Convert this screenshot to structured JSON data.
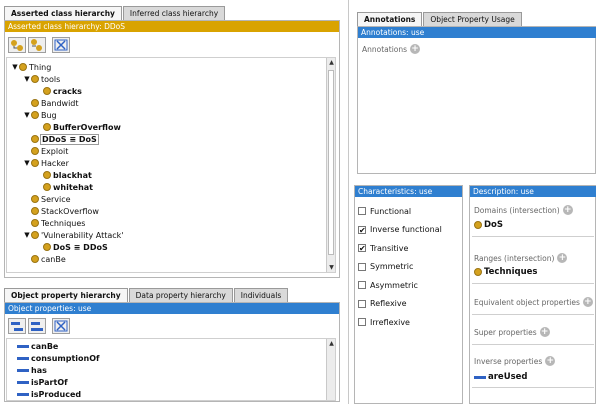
{
  "left_tabs": [
    "Asserted class hierarchy",
    "Inferred class hierarchy"
  ],
  "class_header": "Asserted class hierarchy: DDoS",
  "class_tree": [
    {
      "label": "Thing",
      "expanded": true,
      "bold": false
    },
    {
      "label": "tools",
      "expanded": true,
      "bold": false
    },
    {
      "label": "cracks",
      "bold": true
    },
    {
      "label": "Bandwidt",
      "bold": false
    },
    {
      "label": "Bug",
      "expanded": true,
      "bold": false
    },
    {
      "label": "BufferOverflow",
      "bold": true
    },
    {
      "label": "DDoS ≡ DoS",
      "bold": true,
      "selected": true
    },
    {
      "label": "Exploit",
      "bold": false
    },
    {
      "label": "Hacker",
      "expanded": true,
      "bold": false
    },
    {
      "label": "blackhat",
      "bold": true
    },
    {
      "label": "whitehat",
      "bold": true
    },
    {
      "label": "Service",
      "bold": false
    },
    {
      "label": "StackOverflow",
      "bold": false
    },
    {
      "label": "Techniques",
      "bold": false
    },
    {
      "label": "'Vulnerability Attack'",
      "expanded": true,
      "bold": false
    },
    {
      "label": "DoS ≡ DDoS",
      "bold": true
    },
    {
      "label": "canBe",
      "bold": false
    }
  ],
  "bottom_tabs": [
    "Object property hierarchy",
    "Data property hierarchy",
    "Individuals"
  ],
  "obj_header": "Object properties: use",
  "obj_props": [
    "canBe",
    "consumptionOf",
    "has",
    "isPartOf",
    "isProduced"
  ],
  "right_tabs": [
    "Annotations",
    "Object Property Usage"
  ],
  "annotations_header": "Annotations: use",
  "annotations_label": "Annotations",
  "characteristics_header": "Characteristics: use",
  "characteristics": [
    {
      "label": "Functional",
      "checked": false
    },
    {
      "label": "Inverse functional",
      "checked": true
    },
    {
      "label": "Transitive",
      "checked": true
    },
    {
      "label": "Symmetric",
      "checked": false
    },
    {
      "label": "Asymmetric",
      "checked": false
    },
    {
      "label": "Reflexive",
      "checked": false
    },
    {
      "label": "Irreflexive",
      "checked": false
    }
  ],
  "description_header": "Description: use",
  "description": {
    "domains_label": "Domains (intersection)",
    "domain_value": "DoS",
    "ranges_label": "Ranges (intersection)",
    "range_value": "Techniques",
    "equivalent_label": "Equivalent object properties",
    "super_label": "Super properties",
    "inverse_label": "Inverse properties",
    "inverse_value": "areUsed"
  },
  "colors": {
    "class_header": "#d9a300",
    "property_header": "#2f7fd0",
    "class_dot": "#d4a11e",
    "property_bar": "#2f62c4"
  }
}
